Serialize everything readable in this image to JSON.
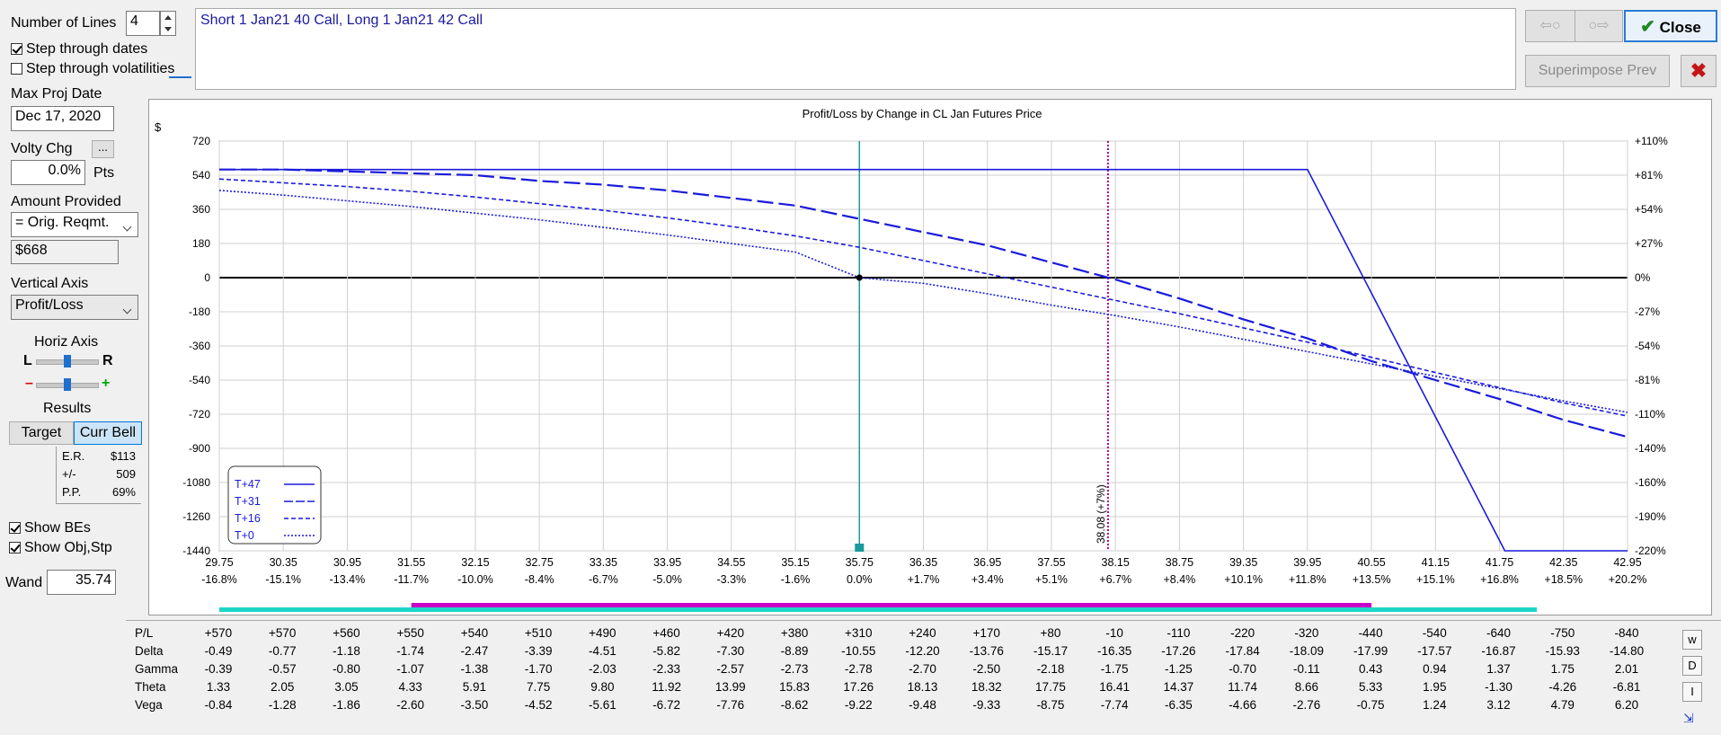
{
  "left_panel": {
    "num_lines_label": "Number of Lines",
    "num_lines_value": "4",
    "step_dates_label": "Step through dates",
    "step_vol_label": "Step through volatilities",
    "max_proj_label": "Max Proj Date",
    "max_proj_value": "Dec 17, 2020",
    "volty_label": "Volty Chg",
    "volty_btn": "...",
    "volty_value": "0.0%",
    "volty_unit": "Pts",
    "amount_label": "Amount Provided",
    "amount_select": "= Orig. Reqmt.",
    "amount_value": "$668",
    "vaxis_label": "Vertical Axis",
    "vaxis_select": "Profit/Loss",
    "haxis_label": "Horiz Axis",
    "haxis_l": "L",
    "haxis_r": "R",
    "haxis_minus": "–",
    "haxis_plus": "+",
    "results_label": "Results",
    "target_tab": "Target",
    "currbell_tab": "Curr Bell",
    "er_label": "E.R.",
    "er_value": "$113",
    "pm_label": "+/-",
    "pm_value": "509",
    "pp_label": "P.P.",
    "pp_value": "69%",
    "show_bes": "Show BEs",
    "show_obj": "Show Obj,Stp",
    "wand_label": "Wand",
    "wand_value": "35.74"
  },
  "description": "Short 1 Jan21 40 Call, Long 1 Jan21 42 Call",
  "toolbar": {
    "close_label": "Close",
    "superimpose_label": "Superimpose Prev",
    "back_arrow": "⇦○",
    "fwd_arrow": "○⇨"
  },
  "colors": {
    "series": "#1a1adc",
    "axis": "#000000",
    "wand": "#1a9a9a",
    "be": "#a0008c",
    "bar_cyan": "#1cd6c8",
    "bar_magenta": "#c800c8"
  },
  "chart_data": {
    "type": "line",
    "title": "Profit/Loss by Change in CL Jan Futures Price",
    "ylabel": "$",
    "ylim": [
      -1440,
      720
    ],
    "yticks": [
      720,
      540,
      360,
      180,
      0,
      -180,
      -360,
      -540,
      -720,
      -900,
      -1080,
      -1260,
      -1440
    ],
    "ytick_labels": [
      "720",
      "540",
      "360",
      "180",
      "0",
      "-180",
      "-360",
      "-540",
      "-720",
      "-900",
      "-1080",
      "-1260",
      "-1440"
    ],
    "y2tick_labels": [
      "+110%",
      "+81%",
      "+54%",
      "+27%",
      "0%",
      "-27%",
      "-54%",
      "-81%",
      "-110%",
      "-140%",
      "-160%",
      "-190%",
      "-220%"
    ],
    "xlim": [
      29.75,
      42.95
    ],
    "x": [
      29.75,
      30.35,
      30.95,
      31.55,
      32.15,
      32.75,
      33.35,
      33.95,
      34.55,
      35.15,
      35.75,
      36.35,
      36.95,
      37.55,
      38.15,
      38.75,
      39.35,
      39.95,
      40.55,
      41.15,
      41.75,
      42.35,
      42.95
    ],
    "x_pct": [
      "-16.8%",
      "-15.1%",
      "-13.4%",
      "-11.7%",
      "-10.0%",
      "-8.4%",
      "-6.7%",
      "-5.0%",
      "-3.3%",
      "-1.6%",
      "0.0%",
      "+1.7%",
      "+3.4%",
      "+5.1%",
      "+6.7%",
      "+8.4%",
      "+10.1%",
      "+11.8%",
      "+13.5%",
      "+15.1%",
      "+16.8%",
      "+18.5%",
      "+20.2%"
    ],
    "series": [
      {
        "name": "T+47",
        "style": "solid",
        "x": [
          29.75,
          39.95,
          41.8,
          42.95
        ],
        "values": [
          570,
          570,
          -1440,
          -1440
        ]
      },
      {
        "name": "T+31",
        "style": "longdash",
        "values": [
          570,
          570,
          560,
          550,
          540,
          510,
          490,
          460,
          420,
          380,
          310,
          240,
          170,
          80,
          -10,
          -110,
          -220,
          -320,
          -440,
          -540,
          -640,
          -750,
          -840
        ]
      },
      {
        "name": "T+16",
        "style": "dash",
        "values": [
          520,
          500,
          480,
          455,
          425,
          390,
          355,
          315,
          270,
          220,
          160,
          90,
          20,
          -50,
          -120,
          -190,
          -265,
          -340,
          -420,
          -500,
          -580,
          -660,
          -730
        ]
      },
      {
        "name": "T+0",
        "style": "dot",
        "values": [
          460,
          435,
          405,
          375,
          340,
          305,
          265,
          225,
          180,
          135,
          0,
          -30,
          -85,
          -145,
          -200,
          -260,
          -325,
          -390,
          -455,
          -520,
          -585,
          -650,
          -710
        ]
      }
    ],
    "wand_x": 35.75,
    "breakeven_x": 38.08,
    "breakeven_label": "38.08 (+7%)",
    "legend_position": "bottom-left"
  },
  "table": {
    "rows": [
      {
        "label": "P/L",
        "values": [
          "+570",
          "+570",
          "+560",
          "+550",
          "+540",
          "+510",
          "+490",
          "+460",
          "+420",
          "+380",
          "+310",
          "+240",
          "+170",
          "+80",
          "-10",
          "-110",
          "-220",
          "-320",
          "-440",
          "-540",
          "-640",
          "-750",
          "-840"
        ]
      },
      {
        "label": "Delta",
        "values": [
          "-0.49",
          "-0.77",
          "-1.18",
          "-1.74",
          "-2.47",
          "-3.39",
          "-4.51",
          "-5.82",
          "-7.30",
          "-8.89",
          "-10.55",
          "-12.20",
          "-13.76",
          "-15.17",
          "-16.35",
          "-17.26",
          "-17.84",
          "-18.09",
          "-17.99",
          "-17.57",
          "-16.87",
          "-15.93",
          "-14.80"
        ]
      },
      {
        "label": "Gamma",
        "values": [
          "-0.39",
          "-0.57",
          "-0.80",
          "-1.07",
          "-1.38",
          "-1.70",
          "-2.03",
          "-2.33",
          "-2.57",
          "-2.73",
          "-2.78",
          "-2.70",
          "-2.50",
          "-2.18",
          "-1.75",
          "-1.25",
          "-0.70",
          "-0.11",
          "0.43",
          "0.94",
          "1.37",
          "1.75",
          "2.01"
        ]
      },
      {
        "label": "Theta",
        "values": [
          "1.33",
          "2.05",
          "3.05",
          "4.33",
          "5.91",
          "7.75",
          "9.80",
          "11.92",
          "13.99",
          "15.83",
          "17.26",
          "18.13",
          "18.32",
          "17.75",
          "16.41",
          "14.37",
          "11.74",
          "8.66",
          "5.33",
          "1.95",
          "-1.30",
          "-4.26",
          "-6.81"
        ]
      },
      {
        "label": "Vega",
        "values": [
          "-0.84",
          "-1.28",
          "-1.86",
          "-2.60",
          "-3.50",
          "-4.52",
          "-5.61",
          "-6.72",
          "-7.76",
          "-8.62",
          "-9.22",
          "-9.48",
          "-9.33",
          "-8.75",
          "-7.74",
          "-6.35",
          "-4.66",
          "-2.76",
          "-0.75",
          "1.24",
          "3.12",
          "4.79",
          "6.20"
        ]
      }
    ],
    "side_w": "w",
    "side_d": "D",
    "side_i": "I"
  }
}
